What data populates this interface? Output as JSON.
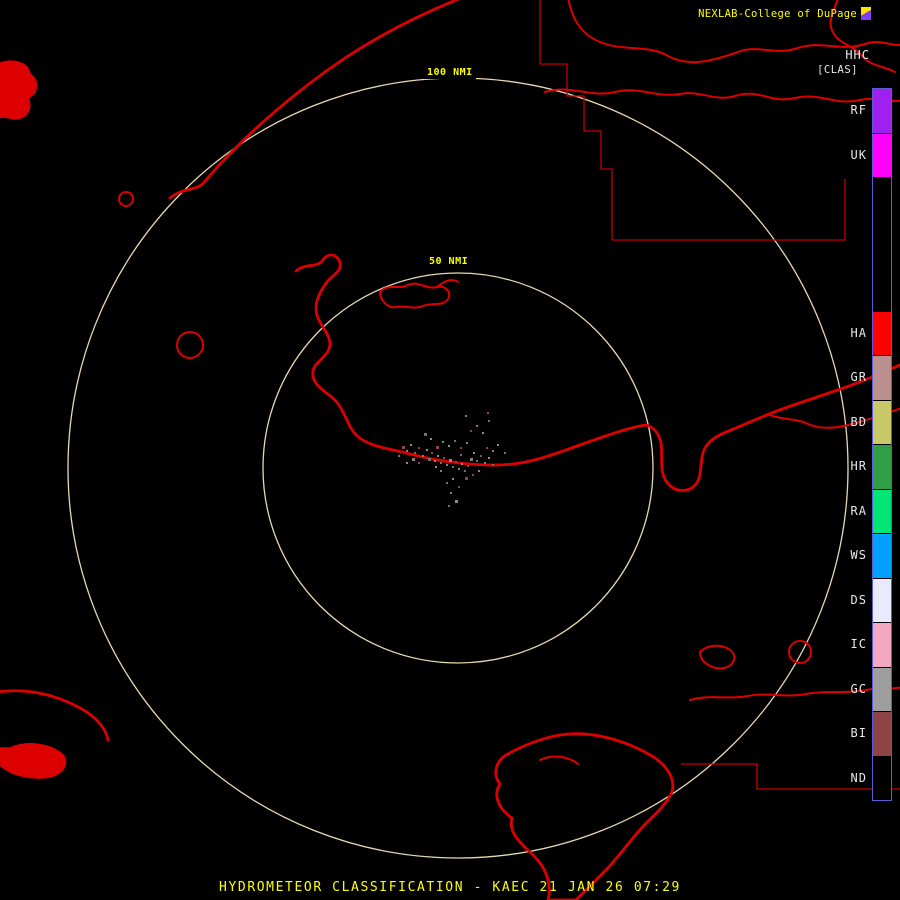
{
  "header": {
    "brand": "NEXLAB-College of DuPage",
    "logo_icon": "cod-logo-icon",
    "product_code": "HHC",
    "product_tag": "[CLAS]"
  },
  "rings": {
    "outer_label": "100 NMI",
    "inner_label": "50 NMI"
  },
  "status_bar": {
    "text": "HYDROMETEOR CLASSIFICATION - KAEC 21 JAN 26 07:29"
  },
  "colors": {
    "background": "#000000",
    "coastline_red": "#dd0000",
    "boundary_red": "#c40000",
    "ring_tan": "#e8d8b2",
    "text_yellow": "#ffff00",
    "text_white": "#e8e8e8",
    "colorbar_border": "#5b5bd6"
  },
  "colorbar": {
    "segments": [
      {
        "label": "RF",
        "color": "#a020f0"
      },
      {
        "label": "UK",
        "color": "#ff00ff"
      },
      {
        "label": "",
        "color": "#000000"
      },
      {
        "label": "",
        "color": "#000000"
      },
      {
        "label": "",
        "color": "#000000"
      },
      {
        "label": "HA",
        "color": "#ff0000"
      },
      {
        "label": "GR",
        "color": "#bc8f8f"
      },
      {
        "label": "BD",
        "color": "#c9c96a"
      },
      {
        "label": "HR",
        "color": "#2f9e44"
      },
      {
        "label": "RA",
        "color": "#00e676"
      },
      {
        "label": "WS",
        "color": "#00a0ff"
      },
      {
        "label": "DS",
        "color": "#eaeaff"
      },
      {
        "label": "IC",
        "color": "#f4a7c3"
      },
      {
        "label": "GC",
        "color": "#9e9e9e"
      },
      {
        "label": "BI",
        "color": "#8e4444"
      },
      {
        "label": "ND",
        "color": "#000000"
      }
    ]
  },
  "radar_echoes": {
    "palette": [
      "#8d7d7d",
      "#9a8888",
      "#7c6c6c",
      "#8e4444"
    ],
    "points": [
      [
        402,
        446
      ],
      [
        406,
        450
      ],
      [
        410,
        444
      ],
      [
        414,
        452
      ],
      [
        418,
        447
      ],
      [
        422,
        455
      ],
      [
        426,
        449
      ],
      [
        428,
        458
      ],
      [
        431,
        452
      ],
      [
        434,
        460
      ],
      [
        437,
        455
      ],
      [
        440,
        462
      ],
      [
        443,
        457
      ],
      [
        446,
        464
      ],
      [
        449,
        459
      ],
      [
        452,
        466
      ],
      [
        455,
        461
      ],
      [
        458,
        468
      ],
      [
        461,
        463
      ],
      [
        464,
        470
      ],
      [
        467,
        465
      ],
      [
        470,
        458
      ],
      [
        473,
        452
      ],
      [
        476,
        460
      ],
      [
        480,
        455
      ],
      [
        484,
        462
      ],
      [
        488,
        457
      ],
      [
        492,
        464
      ],
      [
        436,
        446
      ],
      [
        442,
        441
      ],
      [
        448,
        445
      ],
      [
        454,
        440
      ],
      [
        460,
        447
      ],
      [
        466,
        442
      ],
      [
        430,
        438
      ],
      [
        424,
        433
      ],
      [
        472,
        474
      ],
      [
        478,
        470
      ],
      [
        452,
        478
      ],
      [
        446,
        482
      ],
      [
        458,
        486
      ],
      [
        450,
        492
      ],
      [
        455,
        500
      ],
      [
        448,
        505
      ],
      [
        470,
        430
      ],
      [
        476,
        425
      ],
      [
        482,
        432
      ],
      [
        488,
        420
      ],
      [
        418,
        462
      ],
      [
        412,
        458
      ],
      [
        406,
        462
      ],
      [
        398,
        455
      ],
      [
        486,
        447
      ],
      [
        492,
        450
      ],
      [
        497,
        444
      ],
      [
        504,
        452
      ],
      [
        465,
        477
      ],
      [
        440,
        470
      ],
      [
        435,
        466
      ],
      [
        460,
        454
      ],
      [
        487,
        412
      ],
      [
        465,
        415
      ]
    ]
  }
}
